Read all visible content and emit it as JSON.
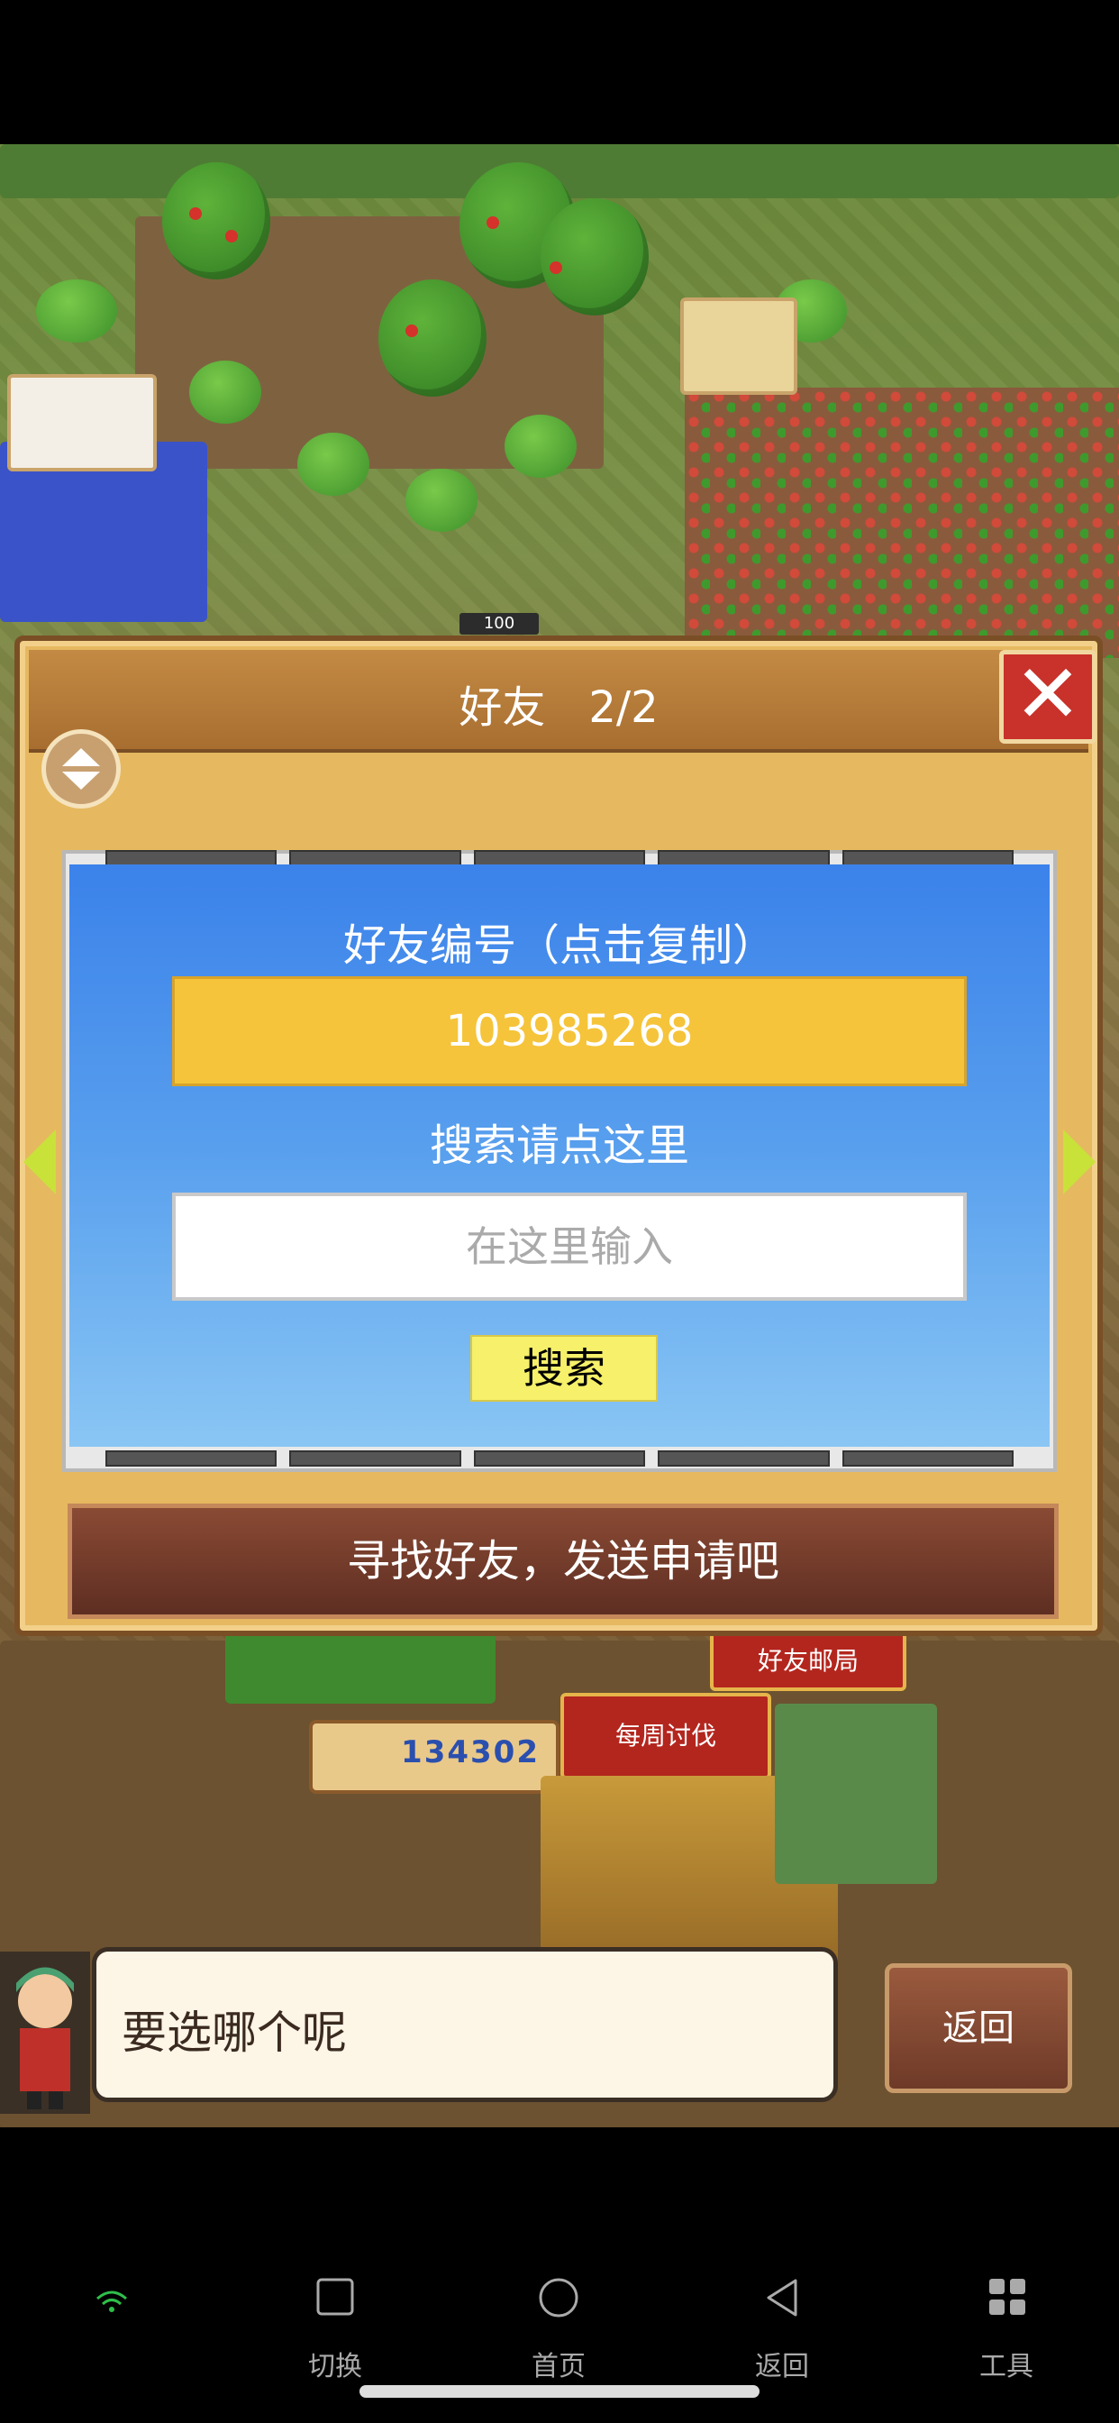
{
  "dialog": {
    "title": "好友　2/2",
    "close_icon": "close-icon",
    "scroll_icon": "up-down-icon",
    "friend_id_label": "好友编号（点击复制）",
    "friend_id": "103985268",
    "search_label": "搜索请点这里",
    "search_placeholder": "在这里输入",
    "search_button": "搜索",
    "apply_banner": "寻找好友，发送申请吧"
  },
  "game": {
    "field_counter": "100",
    "score": "134302",
    "signs": {
      "weekly_raid": "每周讨伐",
      "friend_post": "好友邮局"
    }
  },
  "chat": {
    "speech": "要选哪个呢",
    "back_button": "返回"
  },
  "system_nav": {
    "items": [
      {
        "label": "切换",
        "icon": "square-icon"
      },
      {
        "label": "首页",
        "icon": "circle-icon"
      },
      {
        "label": "返回",
        "icon": "triangle-back-icon"
      },
      {
        "label": "工具",
        "icon": "grid-icon"
      }
    ],
    "status_icon": "wifi-icon"
  },
  "colors": {
    "panel_blue": "#3b82ea",
    "id_yellow": "#f5c43a",
    "close_red": "#c8322a",
    "button_yellow": "#f6f06a"
  }
}
